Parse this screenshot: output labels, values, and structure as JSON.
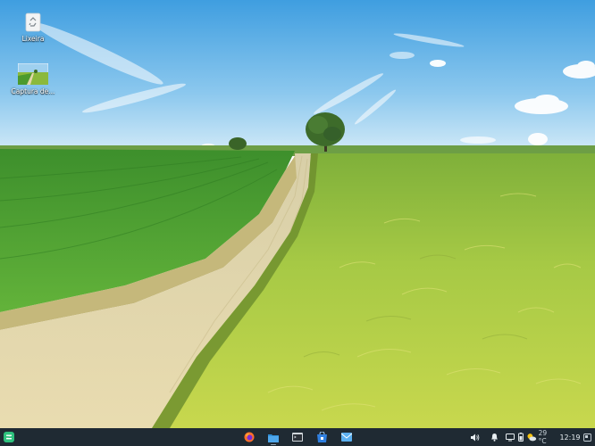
{
  "desktop": {
    "icons": [
      {
        "label": "Lixeira",
        "icon": "trash-icon"
      },
      {
        "label": "Captura de...",
        "icon": "image-thumbnail-icon"
      }
    ]
  },
  "taskbar": {
    "start_icon": "zorin-menu-icon",
    "apps": [
      {
        "name": "firefox",
        "icon": "firefox-icon"
      },
      {
        "name": "files",
        "icon": "folder-icon"
      },
      {
        "name": "terminal",
        "icon": "terminal-icon"
      },
      {
        "name": "software",
        "icon": "software-store-icon"
      },
      {
        "name": "mail",
        "icon": "mail-icon"
      }
    ],
    "tray": {
      "volume_icon": "speaker-icon",
      "notifications_icon": "bell-icon",
      "display_icon": "monitor-icon",
      "battery_icon": "battery-icon",
      "weather_icon": "partly-cloudy-icon",
      "temperature": "29 °C",
      "time": "12:19",
      "corner_icon": "show-desktop-icon"
    }
  },
  "colors": {
    "taskbar_bg": "#1f2a33",
    "sky_top": "#4aa3e0",
    "sky_horizon": "#cfe8f6",
    "field_green": "#4c9a2e",
    "wheat": "#b8c742"
  }
}
